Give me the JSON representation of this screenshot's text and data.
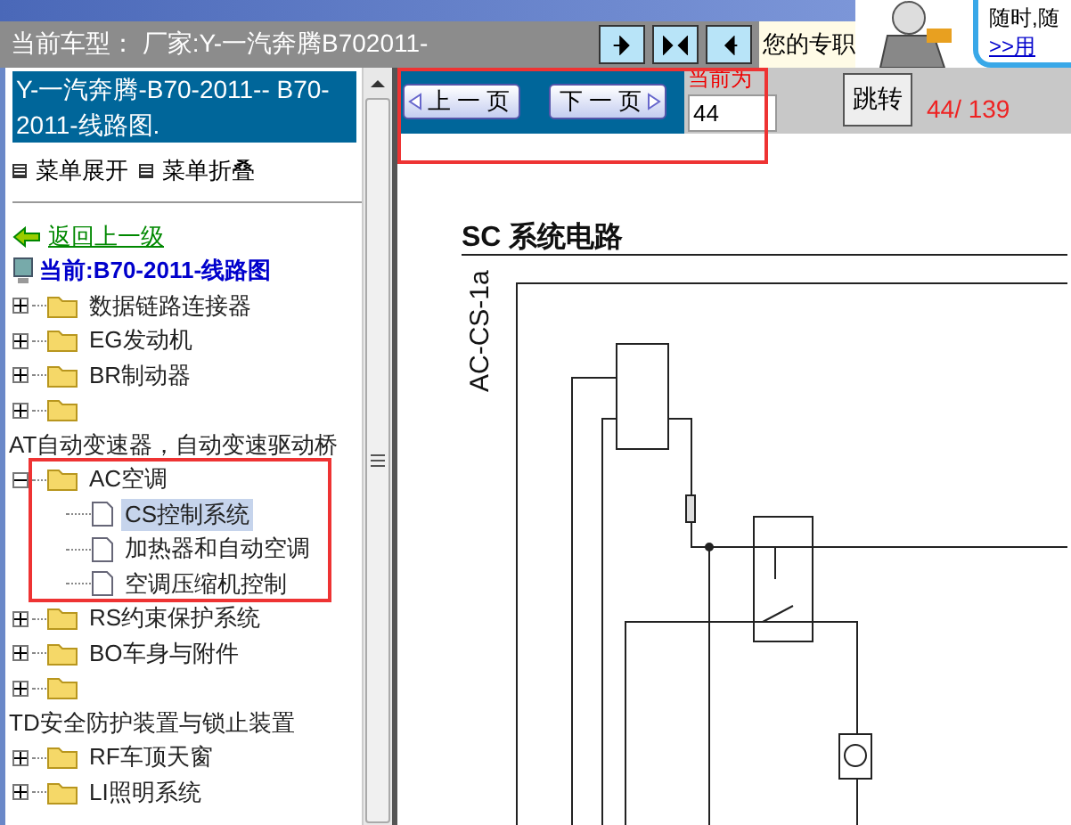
{
  "header": {
    "label": "当前车型：",
    "vehicle": "厂家:Y-一汽奔腾B702011-",
    "notice": "您的专职",
    "promo_lines": [
      "随时,随",
      ">>用"
    ]
  },
  "sidebar": {
    "title": "Y-一汽奔腾-B70-2011-- B70-2011-线路图.",
    "menu_actions": [
      "菜单展开",
      "菜单折叠"
    ],
    "back_link": "返回上一级",
    "current": "当前:B70-2011-线路图",
    "tree": [
      {
        "kind": "folder",
        "label": "数据链路连接器",
        "expanded": false,
        "label_wrapped": false
      },
      {
        "kind": "folder",
        "label": "EG发动机",
        "expanded": false,
        "label_wrapped": false
      },
      {
        "kind": "folder",
        "label": "BR制动器",
        "expanded": false,
        "label_wrapped": false
      },
      {
        "kind": "folder",
        "label": "AT自动变速器，自动变速驱动桥",
        "expanded": false,
        "label_wrapped": true
      },
      {
        "kind": "folder",
        "label": "AC空调",
        "expanded": true,
        "label_wrapped": false,
        "children": [
          {
            "kind": "page",
            "label": "CS控制系统",
            "selected": true
          },
          {
            "kind": "page",
            "label": "加热器和自动空调",
            "selected": false
          },
          {
            "kind": "page",
            "label": "空调压缩机控制",
            "selected": false
          }
        ]
      },
      {
        "kind": "folder",
        "label": "RS约束保护系统",
        "expanded": false,
        "label_wrapped": false
      },
      {
        "kind": "folder",
        "label": "BO车身与附件",
        "expanded": false,
        "label_wrapped": false
      },
      {
        "kind": "folder",
        "label": "TD安全防护装置与锁止装置",
        "expanded": false,
        "label_wrapped": true
      },
      {
        "kind": "folder",
        "label": "RF车顶天窗",
        "expanded": false,
        "label_wrapped": false
      },
      {
        "kind": "folder",
        "label": "LI照明系统",
        "expanded": false,
        "label_wrapped": false
      }
    ]
  },
  "pager": {
    "prev": "上 一 页",
    "next": "下 一 页",
    "page_label": "当前为",
    "page_input": "44",
    "go": "跳转",
    "page_count": "44/ 139"
  },
  "document": {
    "title": "SC 系统电路",
    "sheet_code": "AC-CS-1a"
  }
}
